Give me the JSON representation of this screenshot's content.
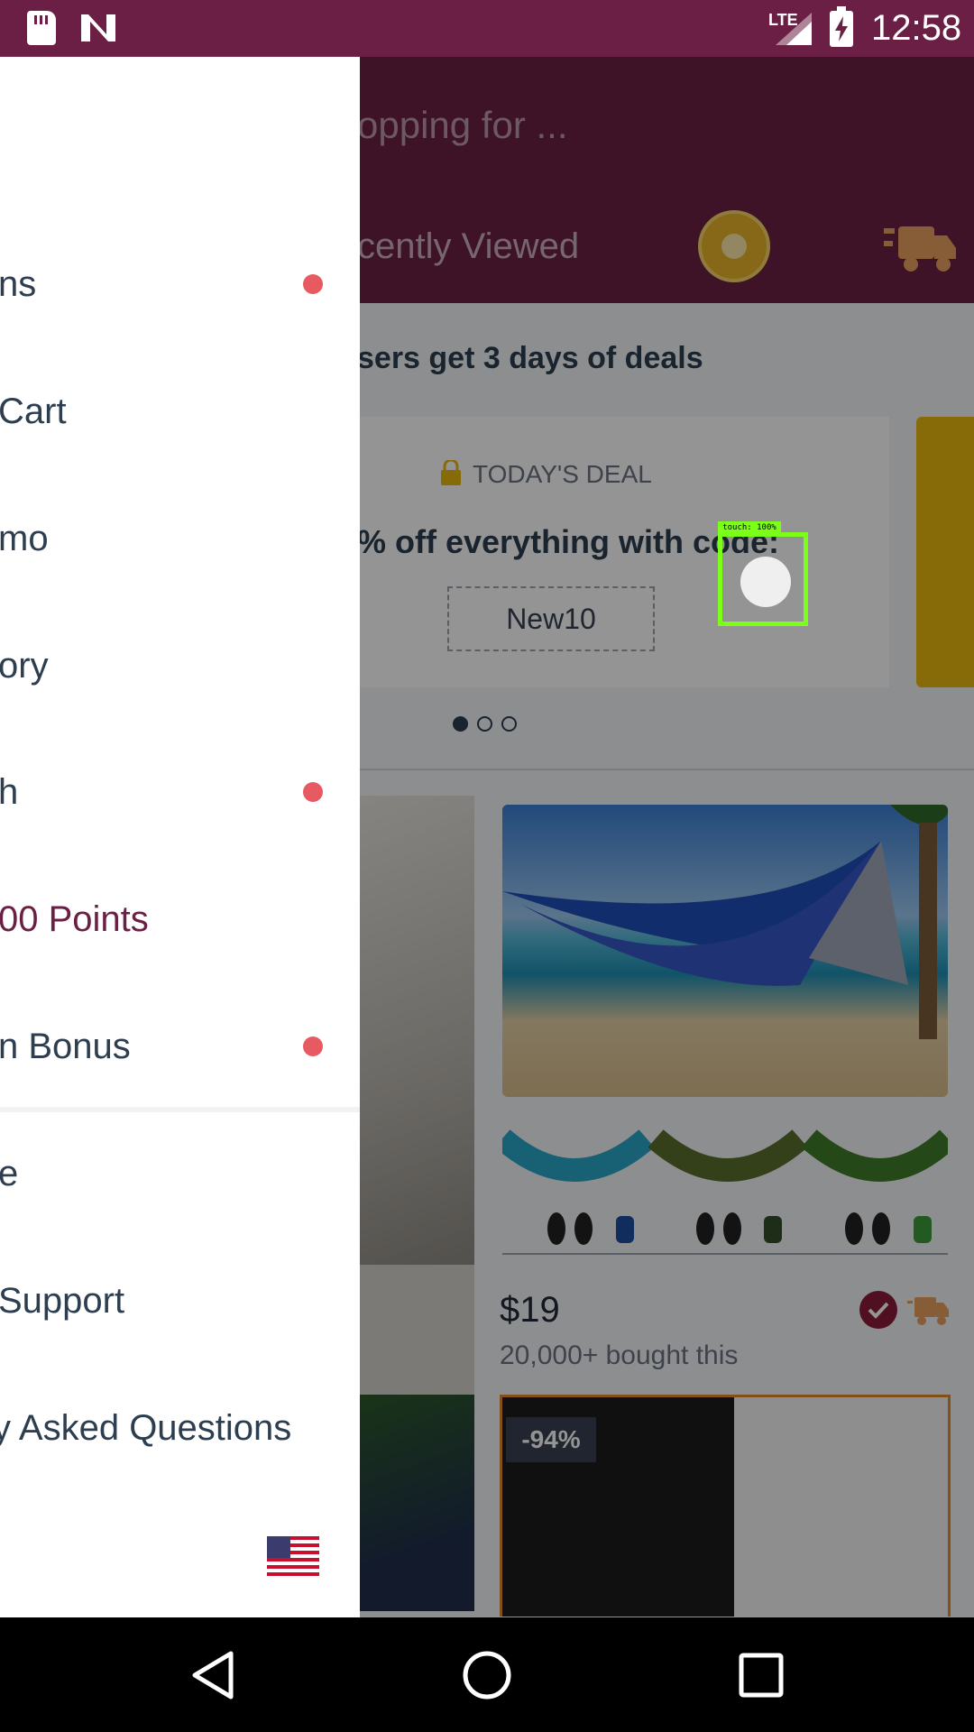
{
  "status_bar": {
    "time": "12:58",
    "network": "LTE",
    "icons": [
      "sd-card-icon",
      "n-notification-icon",
      "signal-icon",
      "battery-charging-icon"
    ]
  },
  "header": {
    "search_placeholder": "opping for ...",
    "recently_viewed": "cently Viewed",
    "icons": [
      "prize-wheel-icon",
      "fast-shipping-truck-icon"
    ]
  },
  "promo": {
    "banner": "sers get 3 days of deals",
    "tag": "TODAY'S DEAL",
    "headline": "% off everything with code:",
    "code": "New10",
    "carousel_pages": 3,
    "carousel_active": 1
  },
  "products": [
    {
      "price": "$19",
      "bought": "20,000+ bought this",
      "icons": [
        "verified-badge-icon",
        "fast-shipping-icon"
      ]
    },
    {
      "discount": "-94%"
    }
  ],
  "drawer": {
    "items": [
      {
        "label": "ns",
        "notification": true
      },
      {
        "label": "Cart",
        "notification": false
      },
      {
        "label": "mo",
        "notification": false
      },
      {
        "label": "ory",
        "notification": false
      },
      {
        "label": "h",
        "notification": true
      },
      {
        "label": "00 Points",
        "notification": false,
        "accent": true
      },
      {
        "label": "n Bonus",
        "notification": true
      },
      {
        "label": "e",
        "notification": false
      },
      {
        "label": "Support",
        "notification": false
      },
      {
        "label": "y Asked Questions",
        "notification": false
      }
    ],
    "flag": "us-flag-icon"
  },
  "touch_indicator": {
    "label": "touch: 100%"
  },
  "colors": {
    "primary": "#6b1f44",
    "accent_dot": "#e85a61",
    "text": "#2c3e50",
    "touch": "#7cff18"
  }
}
